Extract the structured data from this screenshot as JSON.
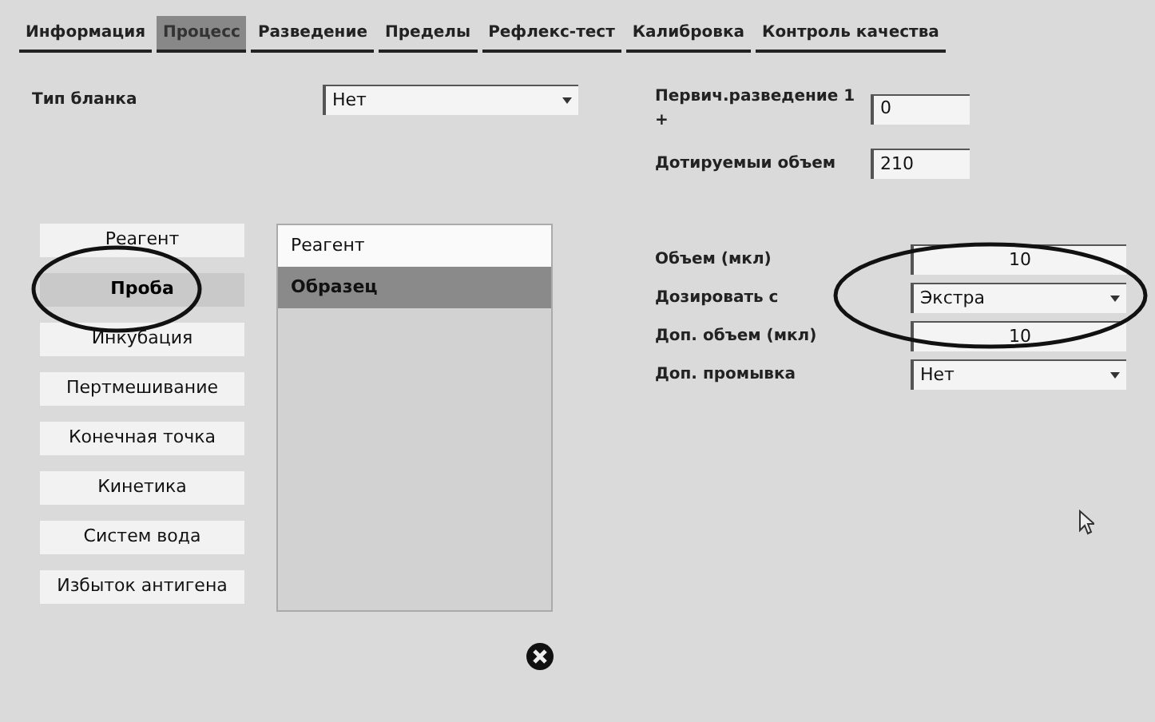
{
  "tabs": [
    {
      "label": "Информация",
      "selected": false
    },
    {
      "label": "Процесс",
      "selected": true
    },
    {
      "label": "Разведение",
      "selected": false
    },
    {
      "label": "Пределы",
      "selected": false
    },
    {
      "label": "Рефлекс-тест",
      "selected": false
    },
    {
      "label": "Калибровка",
      "selected": false
    },
    {
      "label": "Контроль качества",
      "selected": false
    }
  ],
  "form_type": {
    "label": "Тип бланка",
    "value": "Нет"
  },
  "dilution": [
    {
      "label": "Первич.разведение 1 +",
      "value": "0"
    },
    {
      "label": "Дотируемыи объем",
      "value": "210"
    }
  ],
  "steps": [
    {
      "label": "Реагент",
      "selected": false
    },
    {
      "label": "Проба",
      "selected": true
    },
    {
      "label": "Инкубация",
      "selected": false
    },
    {
      "label": "Пертмешивание",
      "selected": false
    },
    {
      "label": "Конечная точка",
      "selected": false
    },
    {
      "label": "Кинетика",
      "selected": false
    },
    {
      "label": "Систем вода",
      "selected": false
    },
    {
      "label": "Избыток антигена",
      "selected": false
    }
  ],
  "components": [
    {
      "label": "Реагент",
      "selected": false
    },
    {
      "label": "Образец",
      "selected": true
    }
  ],
  "settings": [
    {
      "kind": "number",
      "label": "Объем (мкл)",
      "value": "10"
    },
    {
      "kind": "select",
      "label": "Дозировать с",
      "value": "Экстра"
    },
    {
      "kind": "number",
      "label": "Доп. объем (мкл)",
      "value": "10"
    },
    {
      "kind": "select",
      "label": "Доп. промывка",
      "value": "Нет"
    }
  ]
}
